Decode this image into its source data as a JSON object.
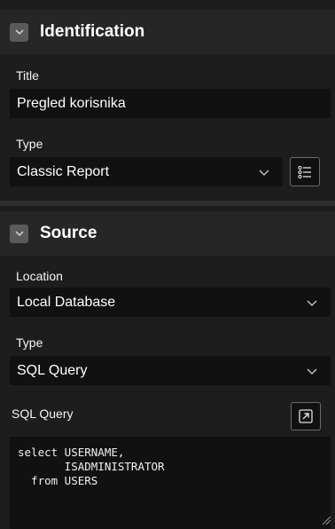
{
  "identification": {
    "header": "Identification",
    "title_label": "Title",
    "title_value": "Pregled korisnika",
    "type_label": "Type",
    "type_value": "Classic Report"
  },
  "source": {
    "header": "Source",
    "location_label": "Location",
    "location_value": "Local Database",
    "type_label": "Type",
    "type_value": "SQL Query",
    "sql_label": "SQL Query",
    "sql_code": "select USERNAME,\n       ISADMINISTRATOR\n  from USERS"
  },
  "icons": {
    "collapse": "chevron-down-icon",
    "template_options": "list-options-icon",
    "expand_editor": "open-external-icon",
    "dropdown": "chevron-down-icon",
    "resize": "resize-grip-icon"
  },
  "colors": {
    "background": "#1d1d1d",
    "header_background": "#262626",
    "input_background": "#111111",
    "text": "#f2f2f2"
  }
}
